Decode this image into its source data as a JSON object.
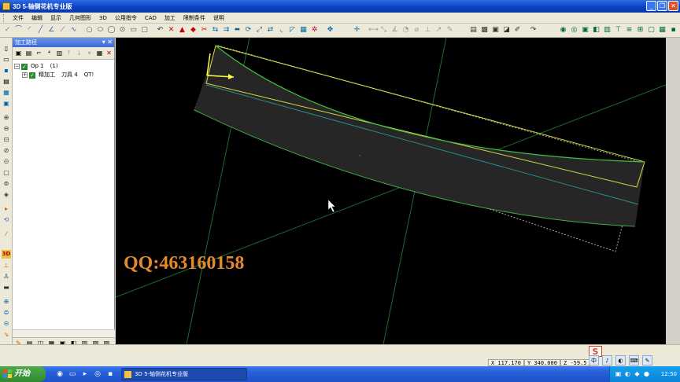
{
  "window": {
    "title": "3D  5-轴侧花机专业版",
    "minimize": "_",
    "restore": "❐",
    "close": "✕"
  },
  "menu": [
    "文件",
    "编辑",
    "显示",
    "几何图形",
    "3D",
    "公用指令",
    "CAD",
    "加工",
    "限制条件",
    "说明"
  ],
  "panel": {
    "title": "加工路径",
    "pin": "▾ ✕",
    "tree": [
      {
        "expander": "−",
        "name": "Op  1",
        "info": "(1)"
      },
      {
        "expander": "+",
        "name": "精加工",
        "info": "刀具 4",
        "extra": "QT!"
      }
    ]
  },
  "viewport": {
    "watermark": "QQ:463160158"
  },
  "status": {
    "x": "X  117.170",
    "y": "Y  340.000",
    "z": "Z  -59.5",
    "ime": [
      "中",
      "♪",
      "◐",
      "⌨",
      "✎"
    ]
  },
  "taskbar": {
    "start": "开始",
    "task_title": "3D 5-轴侧花机专业版",
    "clock": "12:50"
  },
  "icons": {
    "toolbar": [
      "undo-icon",
      "redo-icon",
      "arc-icon",
      "circle-icon",
      "ellipse-icon",
      "zoom-icon",
      "delete-icon",
      "trim-icon"
    ],
    "accent": "#0a3fc0",
    "canvas_bg": "#000000"
  }
}
